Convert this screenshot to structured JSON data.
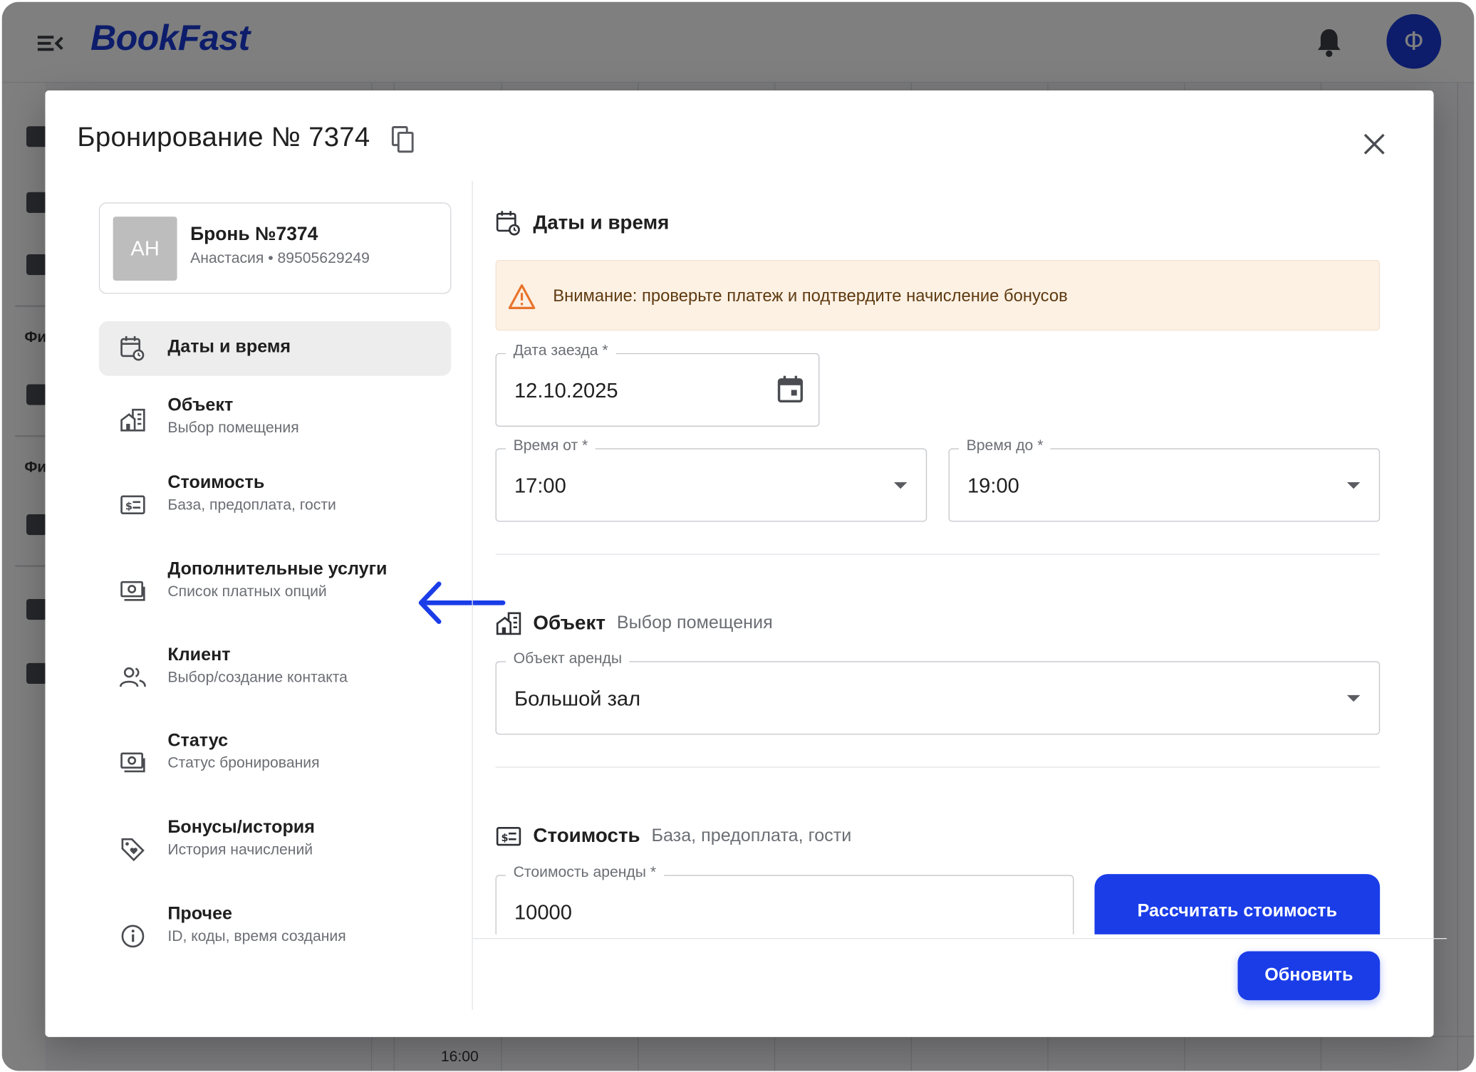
{
  "app": {
    "logo": "BookFast",
    "avatar_letter": "Ф",
    "rail_labels": [
      "Фи",
      "Фи"
    ],
    "time_label": "16:00"
  },
  "modal": {
    "title": "Бронирование № 7374",
    "card": {
      "initials": "АН",
      "title": "Бронь №7374",
      "subtitle": "Анастасия • 89505629249"
    },
    "nav": [
      {
        "title": "Даты и время",
        "sub": "",
        "icon": "calendar-clock-icon",
        "active": true
      },
      {
        "title": "Объект",
        "sub": "Выбор помещения",
        "icon": "building-icon",
        "active": false
      },
      {
        "title": "Стоимость",
        "sub": "База, предоплата, гости",
        "icon": "price-tag-icon",
        "active": false
      },
      {
        "title": "Дополнительные услуги",
        "sub": "Список платных опций",
        "icon": "money-icon",
        "active": false
      },
      {
        "title": "Клиент",
        "sub": "Выбор/создание контакта",
        "icon": "people-icon",
        "active": false
      },
      {
        "title": "Статус",
        "sub": "Статус бронирования",
        "icon": "money-icon",
        "active": false
      },
      {
        "title": "Бонусы/история",
        "sub": "История начислений",
        "icon": "tag-heart-icon",
        "active": false
      },
      {
        "title": "Прочее",
        "sub": "ID, коды, время создания",
        "icon": "info-icon",
        "active": false
      }
    ],
    "dates": {
      "section_title": "Даты и время",
      "alert": "Внимание: проверьте платеж и подтвердите начисление бонусов",
      "checkin_label": "Дата заезда *",
      "checkin_value": "12.10.2025",
      "time_from_label": "Время от *",
      "time_from_value": "17:00",
      "time_to_label": "Время до *",
      "time_to_value": "19:00"
    },
    "object": {
      "section_title": "Объект",
      "section_sub": "Выбор помещения",
      "field_label": "Объект аренды",
      "field_value": "Большой зал"
    },
    "cost": {
      "section_title": "Стоимость",
      "section_sub": "База, предоплата, гости",
      "field_label": "Стоимость аренды *",
      "field_value": "10000",
      "calc_button": "Рассчитать стоимость"
    },
    "update_button": "Обновить"
  },
  "colors": {
    "brand": "#1a3de8",
    "alert_bg": "#fdf1e4",
    "alert_icon": "#e8742c",
    "active_nav_bg": "#ededee",
    "annotation_arrow": "#1a3de8"
  }
}
